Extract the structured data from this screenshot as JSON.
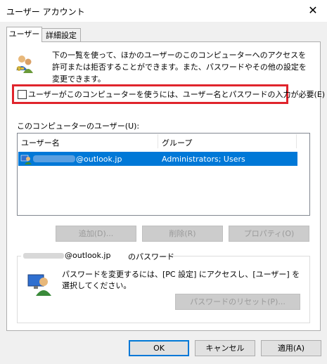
{
  "window": {
    "title": "ユーザー アカウント"
  },
  "tabs": [
    {
      "label": "ユーザー"
    },
    {
      "label": "詳細設定"
    }
  ],
  "description": "下の一覧を使って、ほかのユーザーのこのコンピューターへのアクセスを許可または拒否することができます。また、パスワードやその他の設定を変更できます。",
  "require_login": {
    "checked": false,
    "label": "ユーザーがこのコンピューターを使うには、ユーザー名とパスワードの入力が必要(E)"
  },
  "users_list": {
    "label": "このコンピューターのユーザー(U):",
    "columns": [
      "ユーザー名",
      "グループ"
    ],
    "rows": [
      {
        "username": "@outlook.jp",
        "group": "Administrators; Users"
      }
    ]
  },
  "buttons": {
    "add": "追加(D)...",
    "delete": "削除(R)",
    "properties": "プロパティ(O)",
    "reset_password": "パスワードのリセット(P)...",
    "ok": "OK",
    "cancel": "キャンセル",
    "apply": "適用(A)"
  },
  "password_group": {
    "legend_email": "@outlook.jp",
    "legend_suffix": "のパスワード",
    "description": "パスワードを変更するには、[PC 設定] にアクセスし、[ユーザー] を選択してください。"
  },
  "colors": {
    "selection": "#0078d7",
    "highlight_box": "#e0242c"
  }
}
